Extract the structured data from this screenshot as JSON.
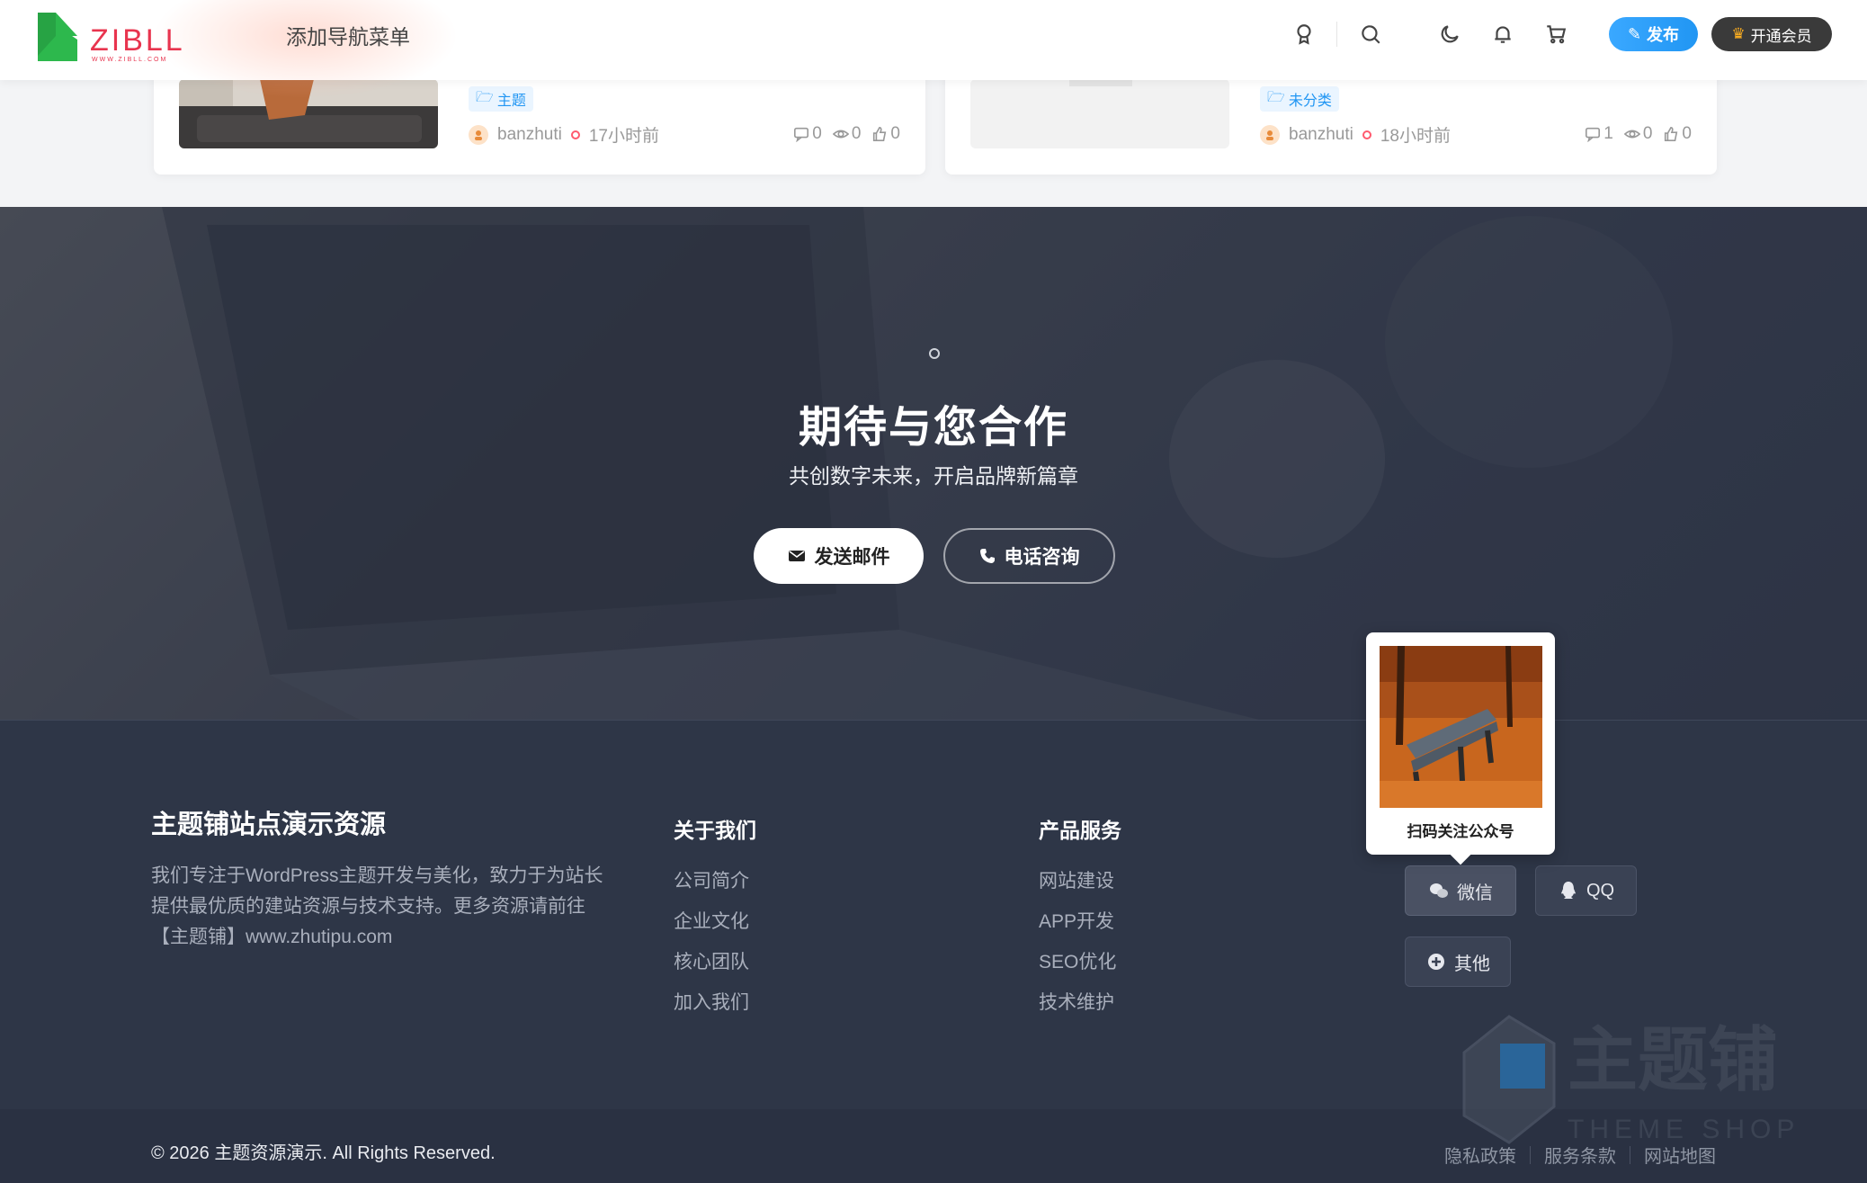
{
  "header": {
    "logo_text": "ZIBLL",
    "logo_sub": "WWW.ZIBLL.COM",
    "nav_menu": "添加导航菜单",
    "publish_label": "发布",
    "vip_label": "开通会员",
    "icons": [
      "medal-icon",
      "search-icon",
      "moon-icon",
      "bell-icon",
      "cart-icon"
    ]
  },
  "cards": [
    {
      "tag": "主题",
      "author": "banzhuti",
      "time": "17小时前",
      "comments": "0",
      "views": "0",
      "likes": "0"
    },
    {
      "tag": "未分类",
      "author": "banzhuti",
      "time": "18小时前",
      "comments": "1",
      "views": "0",
      "likes": "0"
    }
  ],
  "cta": {
    "title": "期待与您合作",
    "subtitle": "共创数字未来，开启品牌新篇章",
    "mail_button": "发送邮件",
    "phone_button": "电话咨询"
  },
  "footer": {
    "brand": "主题铺站点演示资源",
    "description": "我们专注于WordPress主题开发与美化，致力于为站长提供最优质的建站资源与技术支持。更多资源请前往【主题铺】www.zhutipu.com",
    "about_title": "关于我们",
    "about_links": [
      "公司简介",
      "企业文化",
      "核心团队",
      "加入我们"
    ],
    "service_title": "产品服务",
    "service_links": [
      "网站建设",
      "APP开发",
      "SEO优化",
      "技术维护"
    ],
    "qr_caption": "扫码关注公众号",
    "social": {
      "wechat": "微信",
      "qq": "QQ",
      "other": "其他"
    },
    "copyright": "© 2026 主题资源演示. All Rights Reserved.",
    "bottom_links": [
      "隐私政策",
      "服务条款",
      "网站地图"
    ],
    "watermark_cn": "主题铺",
    "watermark_en": "THEME SHOP"
  },
  "colors": {
    "accent": "#2196f3",
    "footer_bg": "#2e3647",
    "brand_green": "#2db84d",
    "brand_pink": "#e8344e"
  }
}
